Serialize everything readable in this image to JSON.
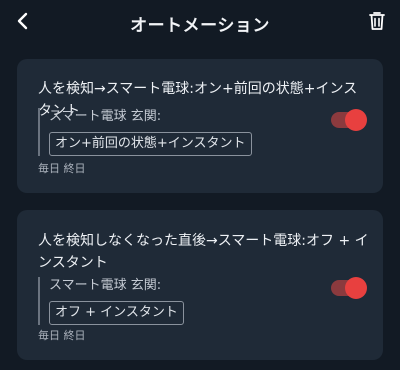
{
  "header": {
    "title": "オートメーション",
    "back_icon": "chevron-left-icon",
    "delete_icon": "trash-icon"
  },
  "automations": [
    {
      "title": "人を検知→スマート電球:オン+前回の状態+インスタント",
      "device": "スマート電球 玄関:",
      "action": "オン+前回の状態+インスタント",
      "schedule": "毎日 終日",
      "enabled": true
    },
    {
      "title": "人を検知しなくなった直後→スマート電球:オフ + インスタント",
      "device": "スマート電球 玄関:",
      "action": "オフ + インスタント",
      "schedule": "毎日 終日",
      "enabled": true
    }
  ],
  "colors": {
    "background": "#121a24",
    "card": "#1f2a37",
    "toggle_on": "#e8403f"
  }
}
